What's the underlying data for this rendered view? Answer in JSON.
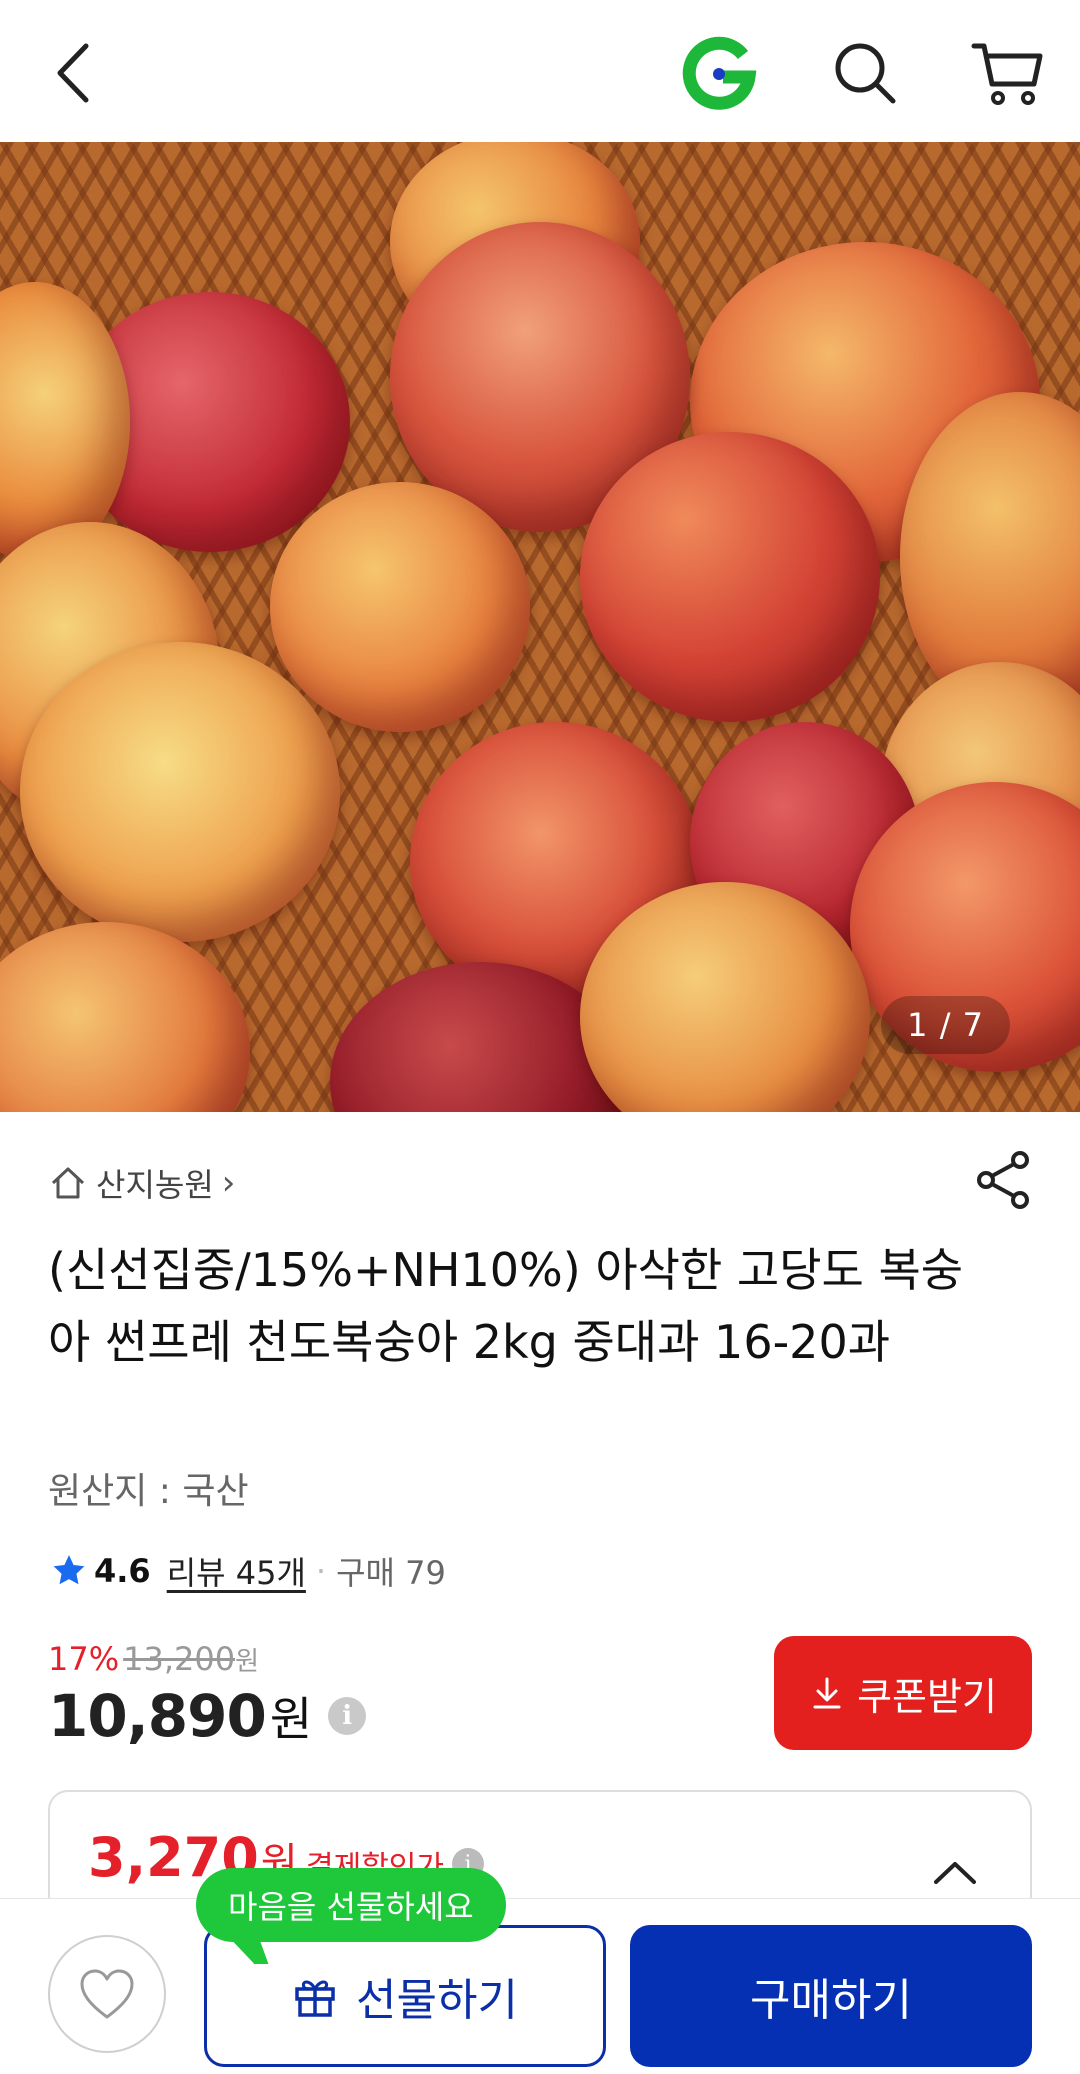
{
  "header": {
    "back_icon": "chevron-left-icon",
    "logo_icon": "g-logo-icon",
    "search_icon": "search-icon",
    "cart_icon": "cart-icon"
  },
  "gallery": {
    "counter": "1 / 7"
  },
  "product": {
    "store": "산지농원",
    "store_chevron": "›",
    "title": "(신선집중/15%+NH10%) 아삭한 고당도 복숭아 썬프레 천도복숭아 2kg 중대과 16-20과",
    "origin": "원산지 : 국산",
    "rating": "4.6",
    "reviews": "리뷰 45개",
    "purchases": "구매 79",
    "discount_percent": "17%",
    "original_price": "13,200",
    "original_price_unit": "원",
    "price": "10,890",
    "price_unit": "원",
    "coupon_button": "쿠폰받기",
    "benefit_price": "3,270",
    "benefit_price_unit": "원",
    "benefit_label": "결제할인가"
  },
  "bottom_bar": {
    "tooltip": "마음을 선물하세요",
    "gift_button": "선물하기",
    "buy_button": "구매하기"
  },
  "colors": {
    "accent_red": "#e4212a",
    "brand_blue": "#0630b3",
    "gift_green": "#1ec83a",
    "logo_green": "#1db83a"
  }
}
